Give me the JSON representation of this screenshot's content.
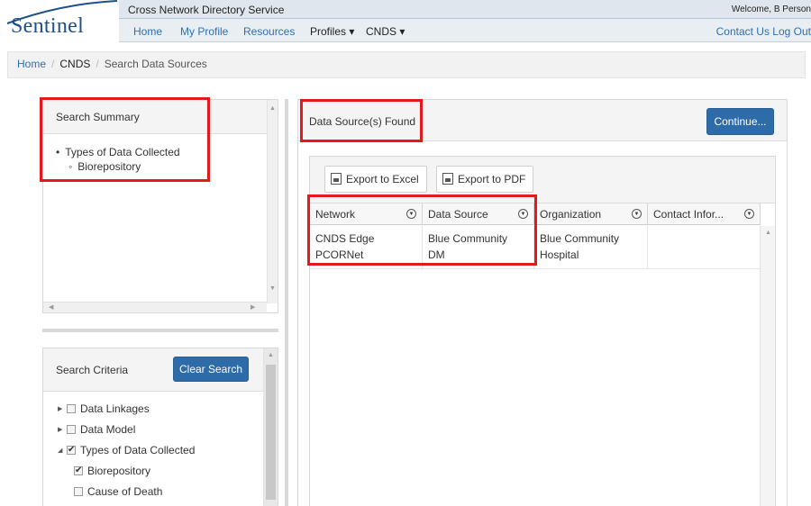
{
  "header": {
    "logo_text": "Sentinel",
    "service_title": "Cross Network Directory Service",
    "welcome": "Welcome, B Person",
    "nav": {
      "home": "Home",
      "my_profile": "My Profile",
      "resources": "Resources",
      "profiles": "Profiles ▾",
      "cnds": "CNDS ▾"
    },
    "right_links": "Contact Us  Log Out"
  },
  "breadcrumb": {
    "home": "Home",
    "cnds": "CNDS",
    "current": "Search Data Sources"
  },
  "summary_panel": {
    "title": "Search Summary",
    "item": "Types of Data Collected",
    "subitem": "Biorepository"
  },
  "criteria_panel": {
    "title": "Search Criteria",
    "clear_button": "Clear Search",
    "tree": [
      {
        "label": "Data Linkages",
        "checked": false
      },
      {
        "label": "Data Model",
        "checked": false
      },
      {
        "label": "Types of Data Collected",
        "checked": true
      },
      {
        "label": "Biorepository",
        "checked": true
      },
      {
        "label": "Cause of Death",
        "checked": false
      }
    ]
  },
  "results_panel": {
    "title": "Data Source(s) Found",
    "continue_button": "Continue...",
    "export_excel": "Export to Excel",
    "export_pdf": "Export to PDF",
    "columns": [
      "Network",
      "Data Source",
      "Organization",
      "Contact Infor..."
    ],
    "rows": [
      {
        "network_line1": "CNDS Edge",
        "network_line2": "PCORNet",
        "data_source_line1": "Blue Community",
        "data_source_line2": "DM",
        "organization_line1": "Blue Community",
        "organization_line2": "Hospital",
        "contact": ""
      }
    ]
  },
  "colors": {
    "brand_blue": "#1e4f8a",
    "link_blue": "#2f6fb0",
    "button_blue": "#2d6ca8",
    "highlight_red": "#e3191b"
  }
}
